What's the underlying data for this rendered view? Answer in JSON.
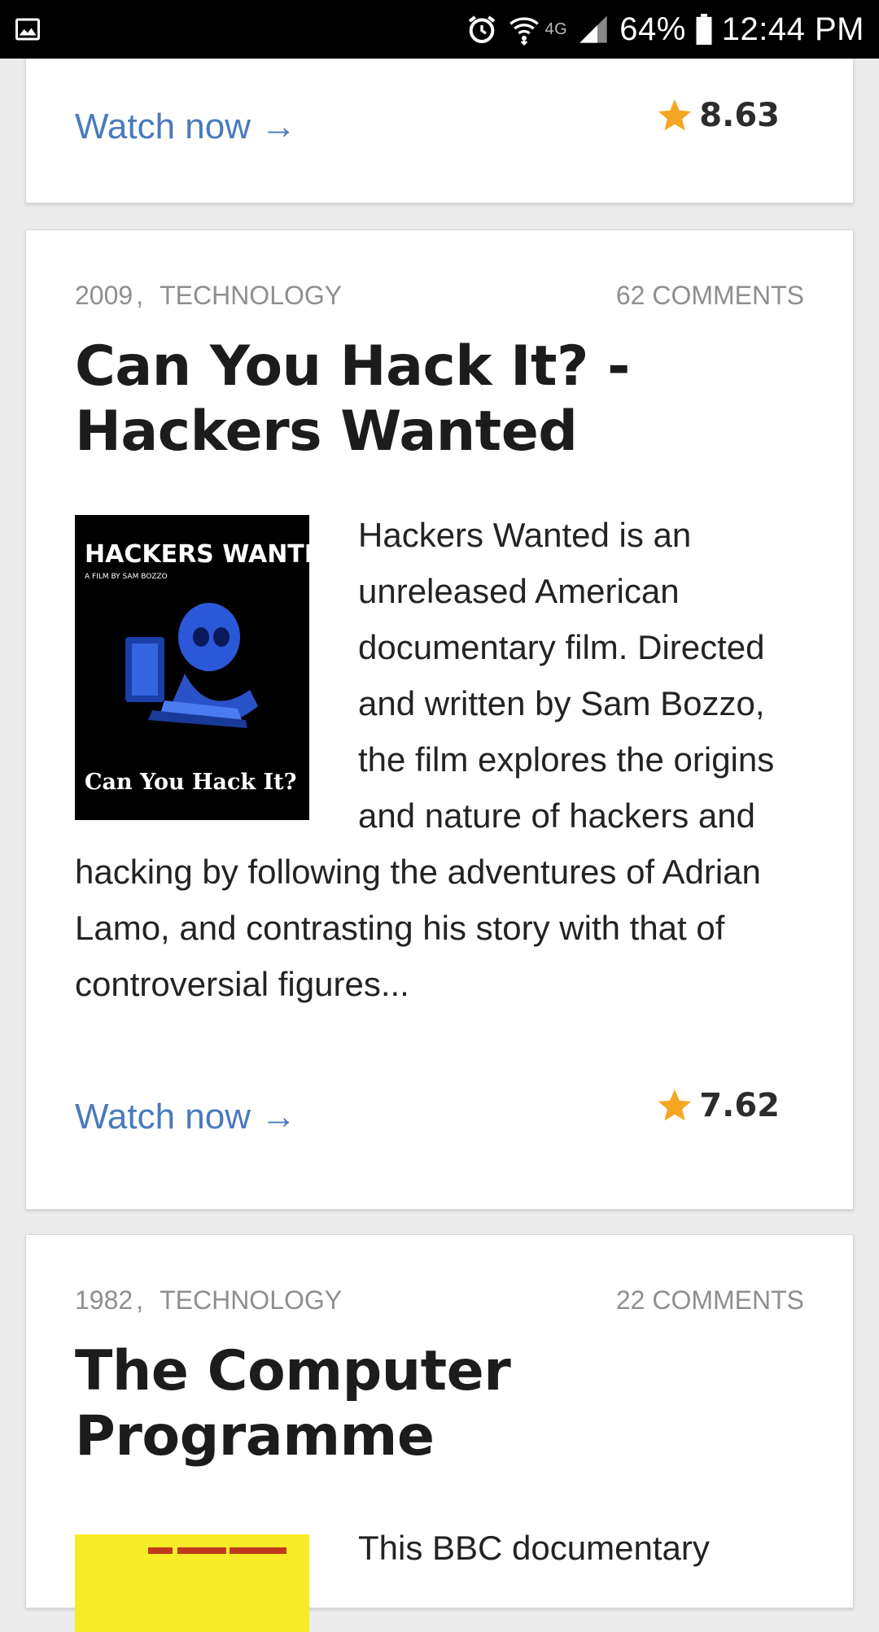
{
  "status_bar": {
    "network": "4G",
    "battery": "64%",
    "time": "12:44 PM"
  },
  "cards": [
    {
      "watch_label": "Watch now →",
      "rating": "8.63"
    },
    {
      "year": "2009",
      "category": "TECHNOLOGY",
      "comments": "62 COMMENTS",
      "title": "Can You Hack It? - Hackers Wanted",
      "description": "Hackers Wanted is an unreleased American documentary film. Directed and written by Sam Bozzo, the film explores the origins and nature of hackers and hacking by following the adventures of Adrian Lamo, and contrasting his story with that of controversial figures...",
      "poster": {
        "title": "HACKERS WANTED",
        "subtitle": "A FILM BY SAM BOZZO",
        "tagline": "Can You Hack It?"
      },
      "watch_label": "Watch now →",
      "rating": "7.62"
    },
    {
      "year": "1982",
      "category": "TECHNOLOGY",
      "comments": "22 COMMENTS",
      "title": "The Computer Programme",
      "description": "This BBC documentary"
    }
  ],
  "colors": {
    "link": "#4a7abd",
    "star": "#f5a623",
    "meta": "#8f8f8f",
    "title": "#1c1c1c",
    "background": "#ececec"
  }
}
